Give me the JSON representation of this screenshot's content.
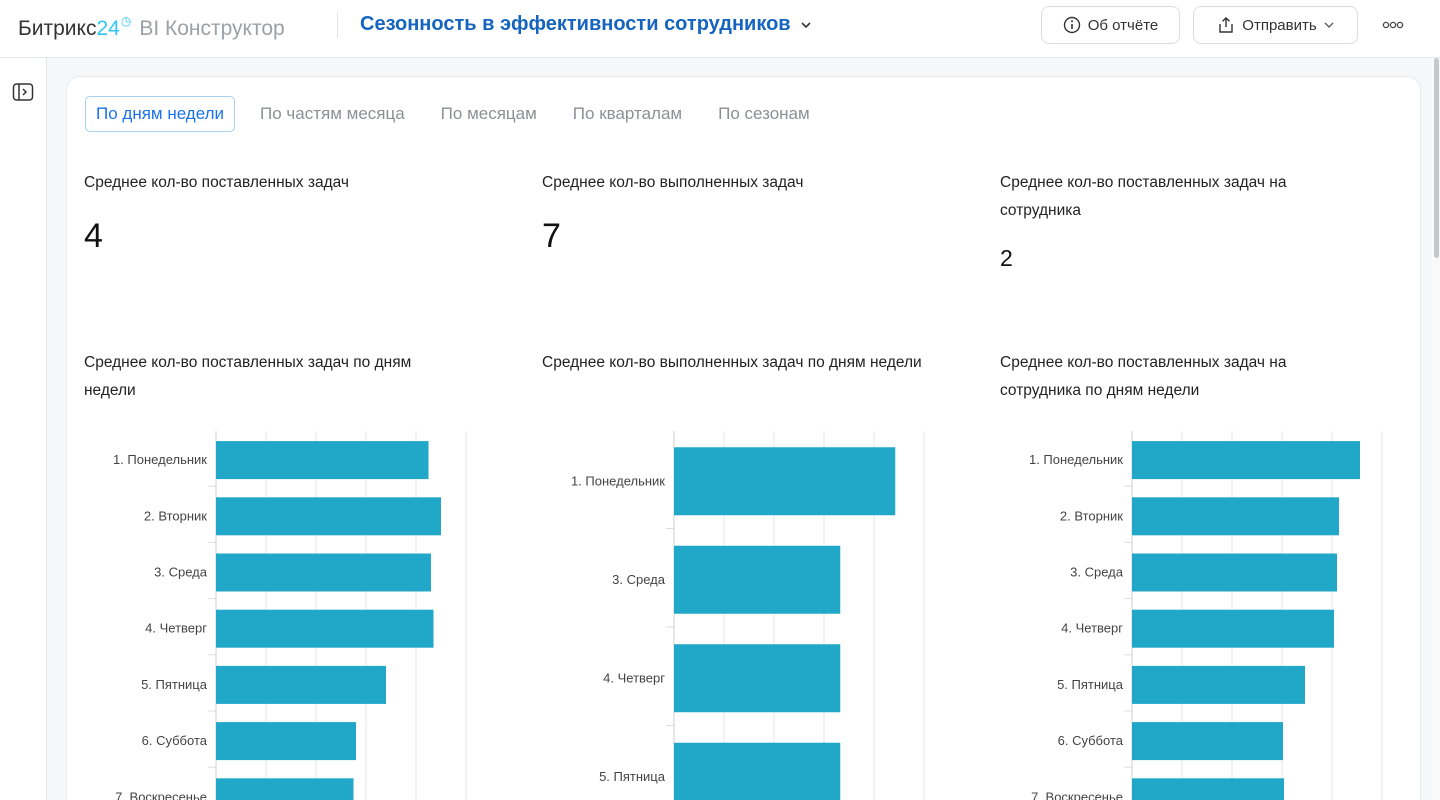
{
  "header": {
    "brand_name": "Битрикс",
    "brand_num": "24",
    "brand_product": "BI Конструктор",
    "report_title": "Сезонность в эффективности сотрудников",
    "about_label": "Об отчёте",
    "send_label": "Отправить"
  },
  "icons": {
    "sidebar_toggle": "sidebar-toggle-icon",
    "info": "info-icon",
    "share": "share-icon",
    "more": "more-icon"
  },
  "colors": {
    "accent": "#1565c0",
    "tab_active": "#1a73e8",
    "bar": "#21a8c8"
  },
  "tabs": [
    {
      "label": "По дням недели",
      "active": true
    },
    {
      "label": "По частям месяца",
      "active": false
    },
    {
      "label": "По месяцам",
      "active": false
    },
    {
      "label": "По кварталам",
      "active": false
    },
    {
      "label": "По сезонам",
      "active": false
    }
  ],
  "kpis": [
    {
      "label": "Среднее кол-во поставленных задач",
      "value": "4"
    },
    {
      "label": "Среднее кол-во выполненных задач",
      "value": "7"
    },
    {
      "label": "Среднее кол-во поставленных задач на сотрудника",
      "value": "2"
    }
  ],
  "chart_data": [
    {
      "type": "bar",
      "orientation": "horizontal",
      "title": "Среднее кол-во поставленных задач по дням недели",
      "categories": [
        "1. Понедельник",
        "2. Вторник",
        "3. Среда",
        "4. Четверг",
        "5. Пятница",
        "6. Суббота",
        "7. Воскресенье"
      ],
      "values": [
        4.25,
        4.5,
        4.3,
        4.35,
        3.4,
        2.8,
        2.75
      ],
      "xlim": [
        0,
        5
      ],
      "grid": true
    },
    {
      "type": "bar",
      "orientation": "horizontal",
      "title": "Среднее кол-во выполненных задач по дням недели",
      "categories": [
        "1. Понедельник",
        "3. Среда",
        "4. Четверг",
        "5. Пятница"
      ],
      "values": [
        8.85,
        6.65,
        6.65,
        6.65
      ],
      "xlim": [
        0,
        10
      ],
      "grid": true
    },
    {
      "type": "bar",
      "orientation": "horizontal",
      "title": "Среднее кол-во поставленных задач на сотрудника по дням недели",
      "categories": [
        "1. Понедельник",
        "2. Вторник",
        "3. Среда",
        "4. Четверг",
        "5. Пятница",
        "6. Суббота",
        "7. Воскресенье"
      ],
      "values": [
        2.28,
        2.07,
        2.05,
        2.02,
        1.73,
        1.51,
        1.52
      ],
      "xlim": [
        0,
        2.5
      ],
      "grid": true
    }
  ]
}
